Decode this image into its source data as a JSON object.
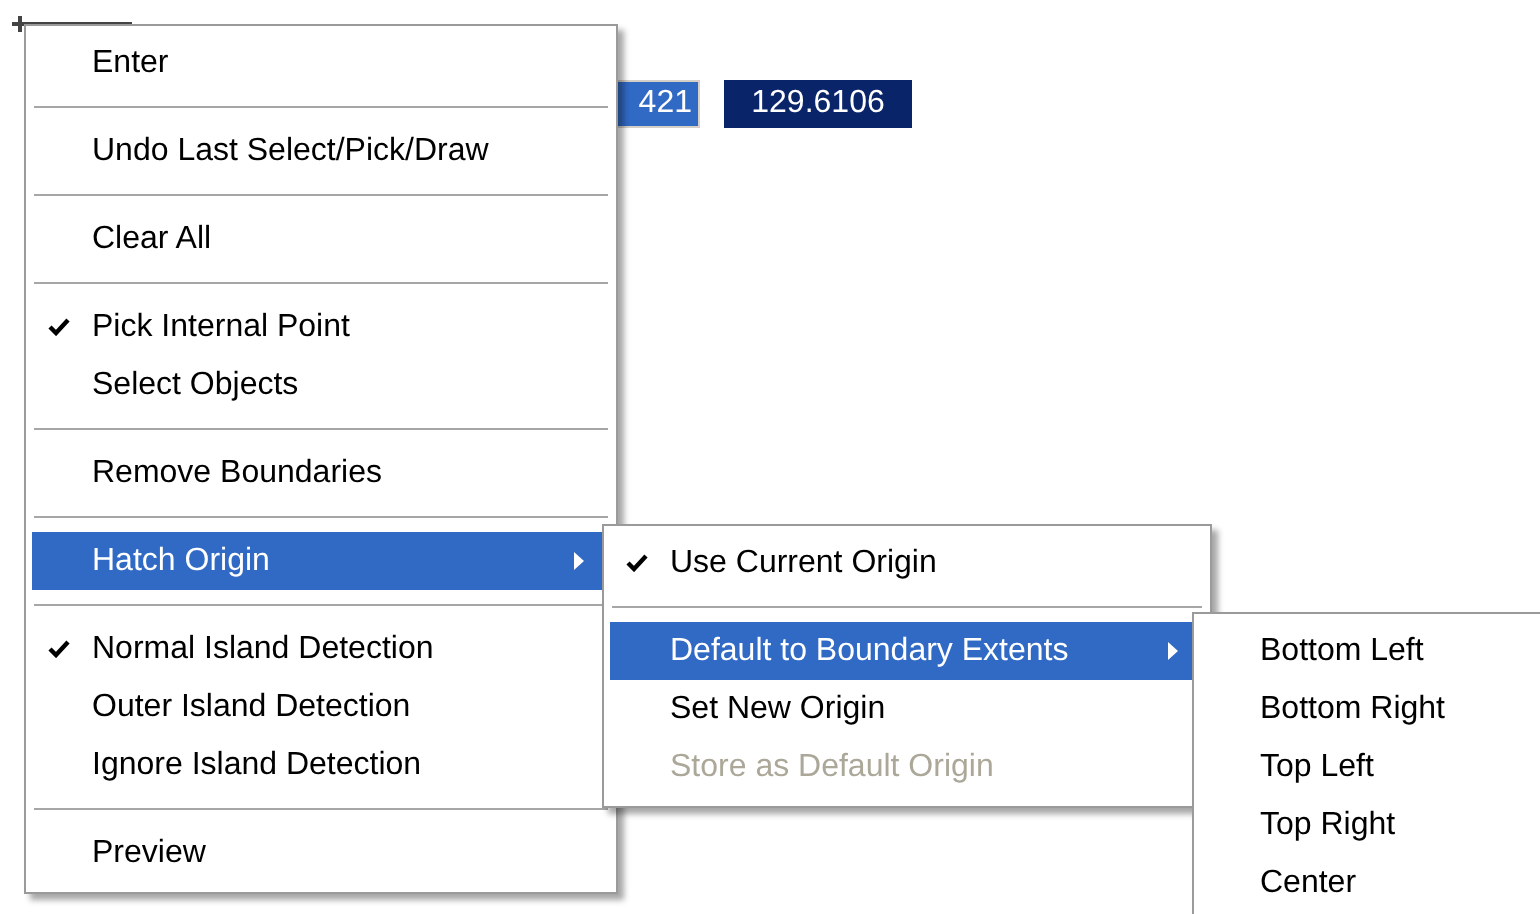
{
  "coordinate_fields": [
    {
      "value": "421",
      "focused": true
    },
    {
      "value": "129.6106",
      "focused": false
    }
  ],
  "context_menu": {
    "items": [
      {
        "kind": "item",
        "label": "Enter",
        "checked": false,
        "selected": false,
        "disabled": false,
        "has_submenu": false
      },
      {
        "kind": "separator"
      },
      {
        "kind": "item",
        "label": "Undo Last Select/Pick/Draw",
        "checked": false,
        "selected": false,
        "disabled": false,
        "has_submenu": false
      },
      {
        "kind": "separator"
      },
      {
        "kind": "item",
        "label": "Clear All",
        "checked": false,
        "selected": false,
        "disabled": false,
        "has_submenu": false
      },
      {
        "kind": "separator"
      },
      {
        "kind": "item",
        "label": "Pick Internal Point",
        "checked": true,
        "selected": false,
        "disabled": false,
        "has_submenu": false
      },
      {
        "kind": "item",
        "label": "Select Objects",
        "checked": false,
        "selected": false,
        "disabled": false,
        "has_submenu": false
      },
      {
        "kind": "separator"
      },
      {
        "kind": "item",
        "label": "Remove Boundaries",
        "checked": false,
        "selected": false,
        "disabled": false,
        "has_submenu": false
      },
      {
        "kind": "separator"
      },
      {
        "kind": "item",
        "label": "Hatch Origin",
        "checked": false,
        "selected": true,
        "disabled": false,
        "has_submenu": true
      },
      {
        "kind": "separator"
      },
      {
        "kind": "item",
        "label": "Normal Island Detection",
        "checked": true,
        "selected": false,
        "disabled": false,
        "has_submenu": false
      },
      {
        "kind": "item",
        "label": "Outer Island Detection",
        "checked": false,
        "selected": false,
        "disabled": false,
        "has_submenu": false
      },
      {
        "kind": "item",
        "label": "Ignore Island Detection",
        "checked": false,
        "selected": false,
        "disabled": false,
        "has_submenu": false
      },
      {
        "kind": "separator"
      },
      {
        "kind": "item",
        "label": "Preview",
        "checked": false,
        "selected": false,
        "disabled": false,
        "has_submenu": false
      }
    ]
  },
  "hatch_origin_submenu": {
    "items": [
      {
        "kind": "item",
        "label": "Use Current Origin",
        "checked": true,
        "selected": false,
        "disabled": false,
        "has_submenu": false
      },
      {
        "kind": "separator"
      },
      {
        "kind": "item",
        "label": "Default to Boundary Extents",
        "checked": false,
        "selected": true,
        "disabled": false,
        "has_submenu": true
      },
      {
        "kind": "item",
        "label": "Set New Origin",
        "checked": false,
        "selected": false,
        "disabled": false,
        "has_submenu": false
      },
      {
        "kind": "item",
        "label": "Store as Default Origin",
        "checked": false,
        "selected": false,
        "disabled": true,
        "has_submenu": false
      }
    ]
  },
  "boundary_extents_submenu": {
    "items": [
      {
        "kind": "item",
        "label": "Bottom Left",
        "checked": false,
        "selected": false,
        "disabled": false,
        "has_submenu": false
      },
      {
        "kind": "item",
        "label": "Bottom Right",
        "checked": false,
        "selected": false,
        "disabled": false,
        "has_submenu": false
      },
      {
        "kind": "item",
        "label": "Top Left",
        "checked": false,
        "selected": false,
        "disabled": false,
        "has_submenu": false
      },
      {
        "kind": "item",
        "label": "Top Right",
        "checked": false,
        "selected": false,
        "disabled": false,
        "has_submenu": false
      },
      {
        "kind": "item",
        "label": "Center",
        "checked": false,
        "selected": false,
        "disabled": false,
        "has_submenu": false
      }
    ]
  }
}
